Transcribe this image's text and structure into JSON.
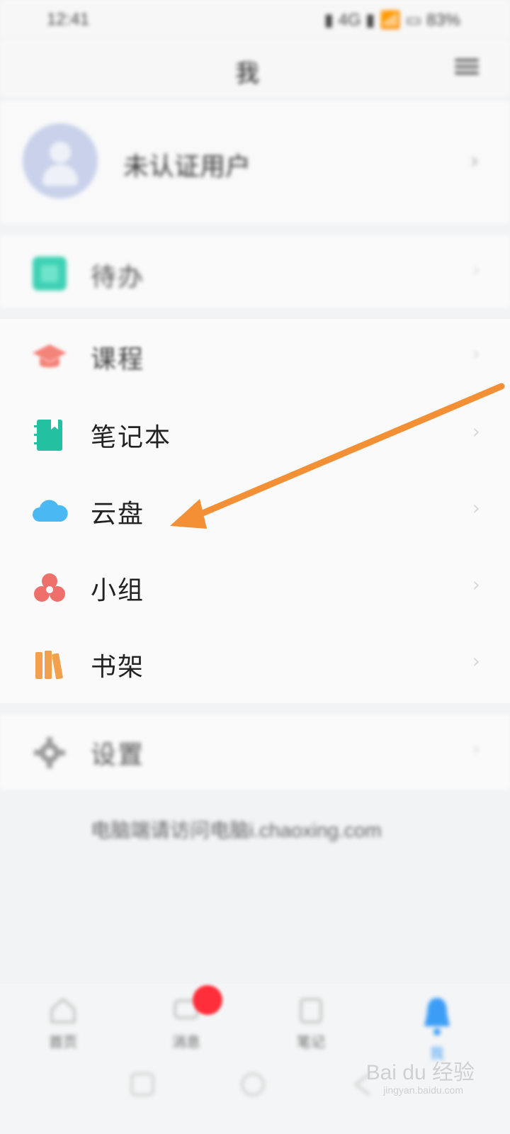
{
  "status_bar": {
    "time": "12:41",
    "right": "▮ 4G ▮ 📶 ▭ 83%"
  },
  "header": {
    "title": "我"
  },
  "profile": {
    "name": "未认证用户"
  },
  "section1": [
    {
      "label": "待办",
      "icon": "todo-icon",
      "color": "#3fd1b4"
    }
  ],
  "section2": [
    {
      "label": "课程",
      "icon": "course-graduation-icon",
      "color": "#f4837a"
    },
    {
      "label": "笔记本",
      "icon": "notebook-icon",
      "color": "#24c0a2"
    },
    {
      "label": "云盘",
      "icon": "cloud-icon",
      "color": "#4ab8f3"
    },
    {
      "label": "小组",
      "icon": "group-icon",
      "color": "#ef6f6a"
    },
    {
      "label": "书架",
      "icon": "bookshelf-icon",
      "color": "#f1a04e"
    }
  ],
  "section3": [
    {
      "label": "设置",
      "icon": "gear-icon",
      "color": "#9a9a9a"
    }
  ],
  "footer": {
    "text": "电脑端请访问电脑i.chaoxing.com"
  },
  "bottom_nav": [
    {
      "label": "首页",
      "icon": "home-icon"
    },
    {
      "label": "消息",
      "icon": "message-icon"
    },
    {
      "label": "笔记",
      "icon": "note-icon"
    },
    {
      "label": "我",
      "icon": "me-icon",
      "color": "#3c9df6"
    }
  ],
  "watermark": {
    "main": "Bai du 经验",
    "sub": "jingyan.baidu.com"
  },
  "annotation": {
    "arrow_color": "#f39035",
    "points_to": "云盘"
  }
}
